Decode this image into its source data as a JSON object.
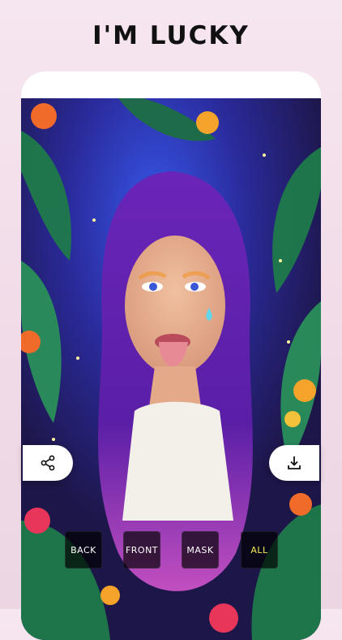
{
  "headline": "I'M LUCKY",
  "actions": {
    "share_icon": "share-icon",
    "download_icon": "download-icon"
  },
  "modes": [
    {
      "label": "BACK",
      "active": false
    },
    {
      "label": "FRONT",
      "active": false
    },
    {
      "label": "MASK",
      "active": false
    },
    {
      "label": "ALL",
      "active": true
    }
  ],
  "colors": {
    "active_mode": "#f4ea52",
    "hair": "#5a1fa6",
    "background_glow": "#2f4bd6"
  }
}
